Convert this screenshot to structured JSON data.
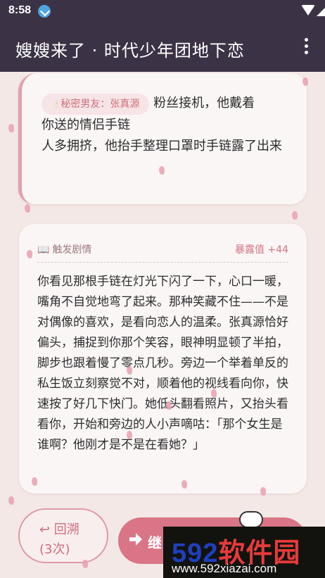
{
  "status_bar": {
    "time": "8:58"
  },
  "app_bar": {
    "title": "嫂嫂来了 · 时代少年团地下恋"
  },
  "card_1": {
    "speaker_icon": "candle",
    "speaker": "秘密男友：张真源",
    "text_1": "粉丝接机，他戴着",
    "text_2": "你送的情侣手链",
    "text_3": "人多拥挤，他抬手整理口罩时手链露了出来"
  },
  "card_2": {
    "header_icon": "open-book",
    "header_label": "触发剧情",
    "exposure_label": "暴露值 +44",
    "story": "你看见那根手链在灯光下闪了一下，心口一暖，嘴角不自觉地弯了起来。那种笑藏不住——不是对偶像的喜欢，是看向恋人的温柔。张真源恰好偏头，捕捉到你那个笑容，眼神明显顿了半拍，脚步也跟着慢了零点几秒。旁边一个举着单反的私生饭立刻察觉不对，顺着他的视线看向你，快速按了好几下快门。她低头翻看照片，又抬头看看你，开始和旁边的人小声嘀咕：「那个女生是谁啊？他刚才是不是在看她？」"
  },
  "buttons": {
    "rewind_label": "↩ 回溯",
    "rewind_count": "(3次)",
    "continue_label": "继"
  },
  "watermark": {
    "main_digits": "592",
    "main_cn": "软件园",
    "url": "www.592xiazai.com"
  },
  "colors": {
    "accent": "#d97586",
    "header_bg": "#3b3345",
    "page_bg": "#f3e8e6"
  }
}
